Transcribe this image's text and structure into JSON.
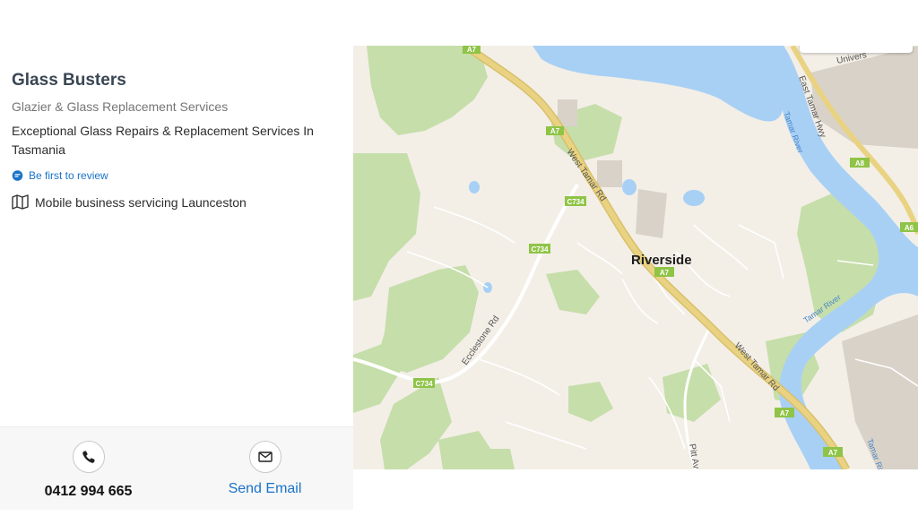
{
  "listing": {
    "title": "Glass Busters",
    "category": "Glazier & Glass Replacement Services",
    "tagline": "Exceptional Glass Repairs & Replacement Services In Tasmania",
    "review_link": "Be first to review",
    "service_area": "Mobile business servicing Launceston"
  },
  "contact": {
    "phone": "0412 994 665",
    "email_label": "Send Email"
  },
  "map": {
    "town": "Riverside",
    "roads": {
      "west_tamar_rd": "West Tamar Rd",
      "east_tamar_hwy": "East Tamar Hwy",
      "ecclestone_rd": "Ecclestone Rd",
      "pitt_av": "Pitt Av",
      "university": "Univers"
    },
    "shields": {
      "a7": "A7",
      "a8": "A8",
      "a6": "A6",
      "c734": "C734"
    },
    "rivers": {
      "tamar_river": "Tamar River",
      "tamar_river_2": "Tamar River",
      "tamar_river_3": "Tamar River"
    },
    "colors": {
      "water": "#a8d0f5",
      "park": "#c6deaa",
      "land": "#f3efe7",
      "road": "#e6cf7e",
      "urban": "#d8d2c8",
      "shield": "#8fc447"
    }
  },
  "colors": {
    "accent": "#1a73c8",
    "title": "#3a4654"
  }
}
